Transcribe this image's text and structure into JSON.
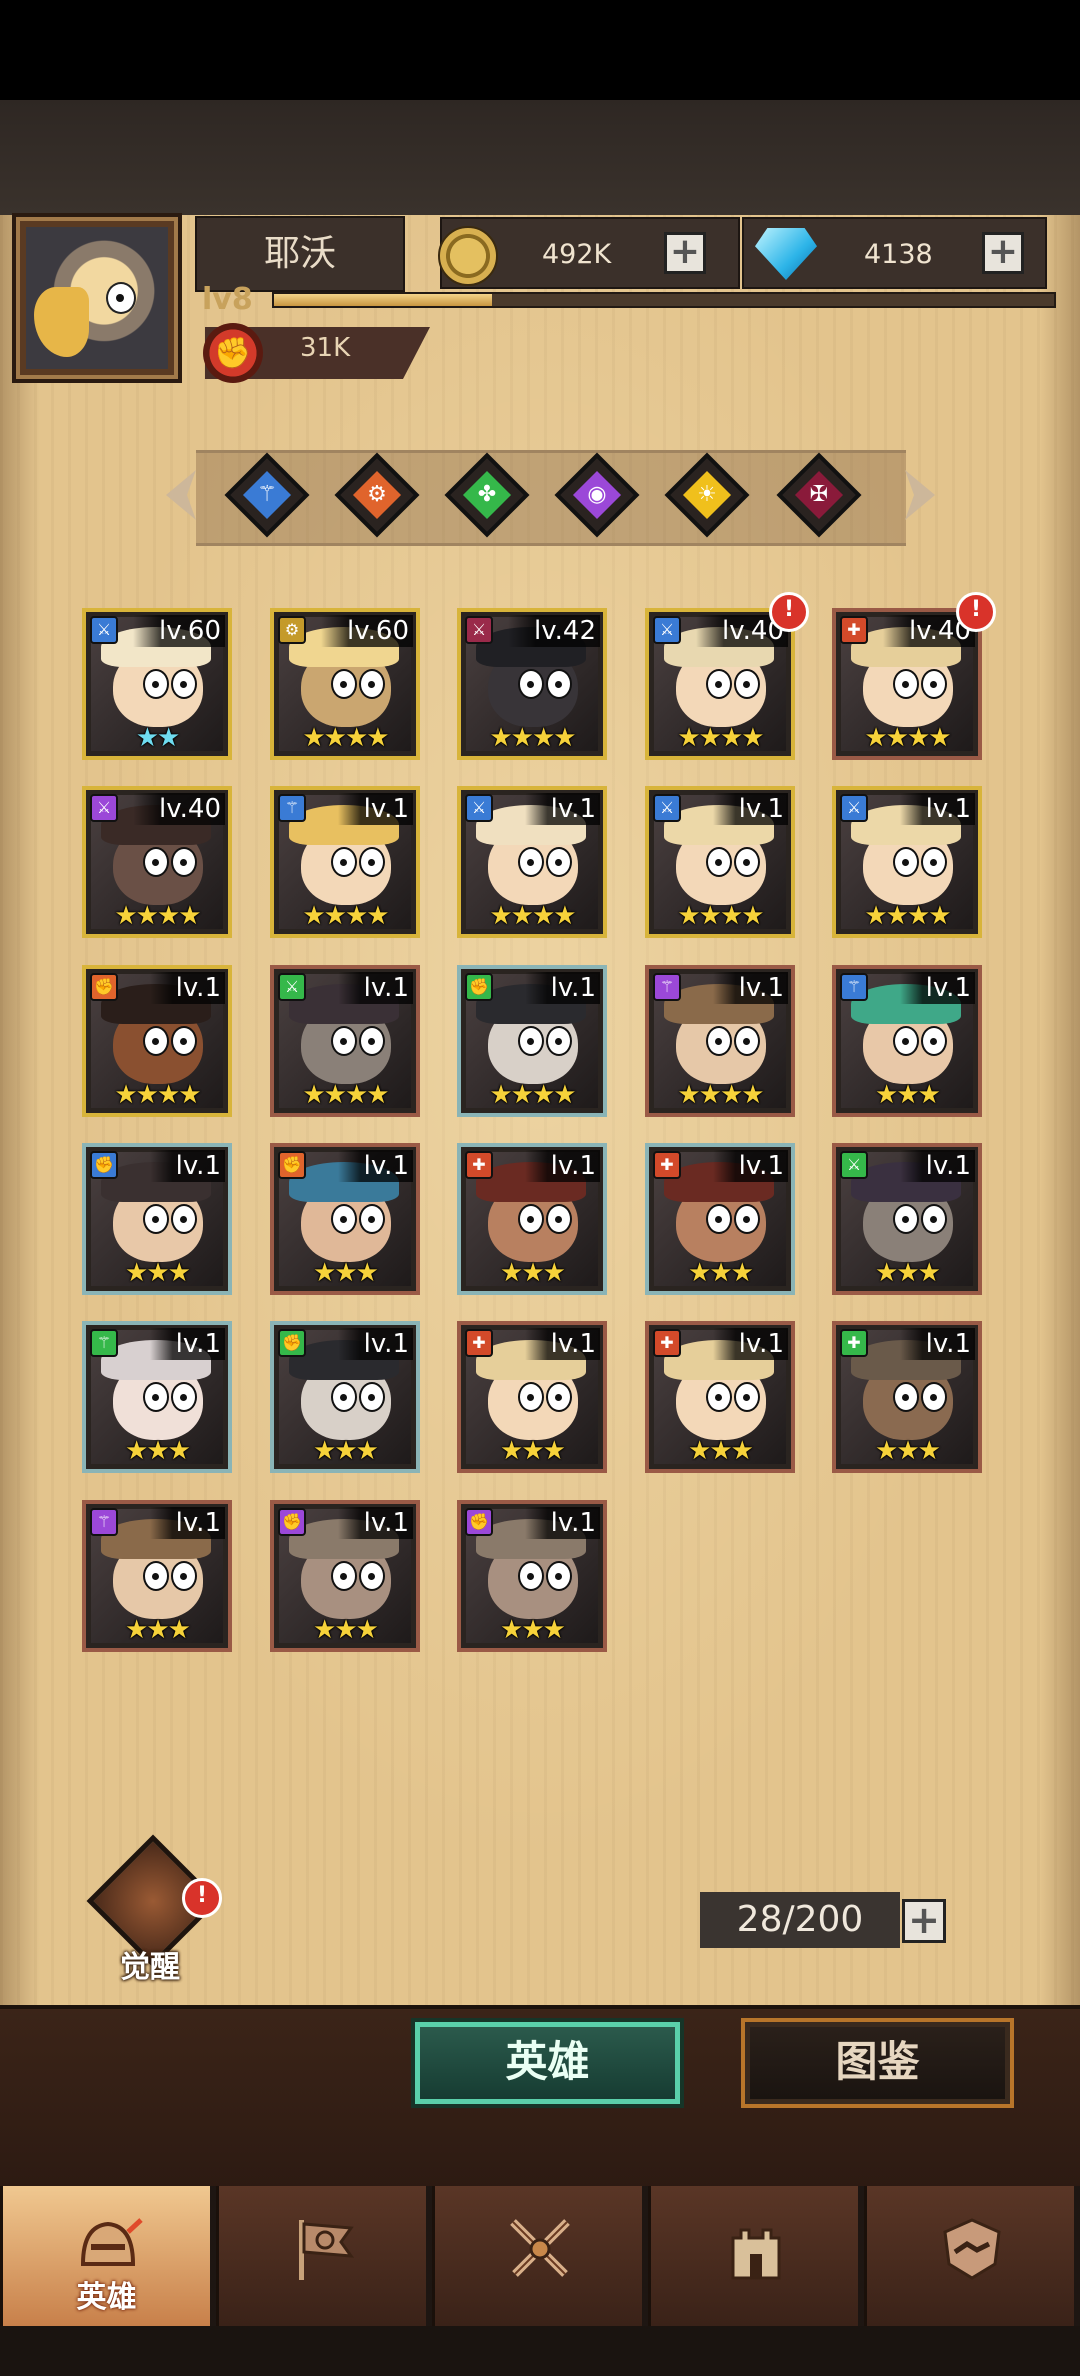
{
  "player": {
    "name": "耶沃",
    "level": "lv8",
    "power": "31K",
    "xp_fraction": 0.28
  },
  "resources": {
    "gold": "492K",
    "gems": "4138"
  },
  "element_filters": [
    {
      "icon": "water-rune-icon",
      "color": "#3a7bd5",
      "glyph": "⚚"
    },
    {
      "icon": "fire-rune-icon",
      "color": "#e0642c",
      "glyph": "⚙"
    },
    {
      "icon": "nature-rune-icon",
      "color": "#35b84a",
      "glyph": "✤"
    },
    {
      "icon": "arcane-rune-icon",
      "color": "#9b48d8",
      "glyph": "◉"
    },
    {
      "icon": "light-rune-icon",
      "color": "#f0c01c",
      "glyph": "☀"
    },
    {
      "icon": "dark-rune-icon",
      "color": "#8a1a3a",
      "glyph": "✠"
    }
  ],
  "heroes": [
    {
      "level": "lv.60",
      "stars": "★★",
      "star_color": "blue",
      "frame": "gold",
      "class_color": "#3a7bd5",
      "class_glyph": "⚔",
      "alert": false,
      "hair": "#f2e6c8",
      "skin": "#f3d8b8"
    },
    {
      "level": "lv.60",
      "stars": "★★★★",
      "star_color": "gold",
      "frame": "gold",
      "class_color": "#c49a2a",
      "class_glyph": "⚙",
      "alert": false,
      "hair": "#f0d690",
      "skin": "#caa670"
    },
    {
      "level": "lv.42",
      "stars": "★★★★",
      "star_color": "gold",
      "frame": "gold",
      "class_color": "#9a2a4a",
      "class_glyph": "⚔",
      "alert": false,
      "hair": "#202024",
      "skin": "#383438"
    },
    {
      "level": "lv.40",
      "stars": "★★★★",
      "star_color": "gold",
      "frame": "gold",
      "class_color": "#3a7bd5",
      "class_glyph": "⚔",
      "alert": true,
      "hair": "#e8d8b0",
      "skin": "#f3d8b8"
    },
    {
      "level": "lv.40",
      "stars": "★★★★",
      "star_color": "gold",
      "frame": "red",
      "class_color": "#d34a2a",
      "class_glyph": "✚",
      "alert": true,
      "hair": "#e6cf9a",
      "skin": "#f3d8b8"
    },
    {
      "level": "lv.40",
      "stars": "★★★★",
      "star_color": "gold",
      "frame": "gold",
      "class_color": "#9b48d8",
      "class_glyph": "⚔",
      "alert": false,
      "hair": "#3a2a26",
      "skin": "#6a5046"
    },
    {
      "level": "lv.1",
      "stars": "★★★★",
      "star_color": "gold",
      "frame": "gold",
      "class_color": "#3a7bd5",
      "class_glyph": "⚚",
      "alert": false,
      "hair": "#e8c060",
      "skin": "#f3d8b8"
    },
    {
      "level": "lv.1",
      "stars": "★★★★",
      "star_color": "gold",
      "frame": "gold",
      "class_color": "#3a7bd5",
      "class_glyph": "⚔",
      "alert": false,
      "hair": "#f0e0c0",
      "skin": "#f3d8b8"
    },
    {
      "level": "lv.1",
      "stars": "★★★★",
      "star_color": "gold",
      "frame": "gold",
      "class_color": "#3a7bd5",
      "class_glyph": "⚔",
      "alert": false,
      "hair": "#ecd8a8",
      "skin": "#f3d8b8"
    },
    {
      "level": "lv.1",
      "stars": "★★★★",
      "star_color": "gold",
      "frame": "gold",
      "class_color": "#3a7bd5",
      "class_glyph": "⚔",
      "alert": false,
      "hair": "#ecd8a8",
      "skin": "#f3d8b8"
    },
    {
      "level": "lv.1",
      "stars": "★★★★",
      "star_color": "gold",
      "frame": "gold",
      "class_color": "#e0642c",
      "class_glyph": "✊",
      "alert": false,
      "hair": "#2a1e1a",
      "skin": "#8a5030"
    },
    {
      "level": "lv.1",
      "stars": "★★★★",
      "star_color": "gold",
      "frame": "red",
      "class_color": "#35b84a",
      "class_glyph": "⚔",
      "alert": false,
      "hair": "#3a3036",
      "skin": "#8a8078"
    },
    {
      "level": "lv.1",
      "stars": "★★★★",
      "star_color": "gold",
      "frame": "teal",
      "class_color": "#35b84a",
      "class_glyph": "✊",
      "alert": false,
      "hair": "#2a2a2e",
      "skin": "#d8d0c8"
    },
    {
      "level": "lv.1",
      "stars": "★★★★",
      "star_color": "gold",
      "frame": "red",
      "class_color": "#9b48d8",
      "class_glyph": "⚚",
      "alert": false,
      "hair": "#8a6a4a",
      "skin": "#e6c8a8"
    },
    {
      "level": "lv.1",
      "stars": "★★★",
      "star_color": "gold",
      "frame": "red",
      "class_color": "#3a7bd5",
      "class_glyph": "⚚",
      "alert": false,
      "hair": "#3fa888",
      "skin": "#e8c8a8"
    },
    {
      "level": "lv.1",
      "stars": "★★★",
      "star_color": "gold",
      "frame": "teal",
      "class_color": "#3a7bd5",
      "class_glyph": "✊",
      "alert": false,
      "hair": "#3a3030",
      "skin": "#e8c8a8"
    },
    {
      "level": "lv.1",
      "stars": "★★★",
      "star_color": "gold",
      "frame": "red",
      "class_color": "#e0642c",
      "class_glyph": "✊",
      "alert": false,
      "hair": "#3a7a9a",
      "skin": "#e0b898"
    },
    {
      "level": "lv.1",
      "stars": "★★★",
      "star_color": "gold",
      "frame": "teal",
      "class_color": "#d34a2a",
      "class_glyph": "✚",
      "alert": false,
      "hair": "#6a2a22",
      "skin": "#b88060"
    },
    {
      "level": "lv.1",
      "stars": "★★★",
      "star_color": "gold",
      "frame": "teal",
      "class_color": "#d34a2a",
      "class_glyph": "✚",
      "alert": false,
      "hair": "#6a2a22",
      "skin": "#b88060"
    },
    {
      "level": "lv.1",
      "stars": "★★★",
      "star_color": "gold",
      "frame": "red",
      "class_color": "#35b84a",
      "class_glyph": "⚔",
      "alert": false,
      "hair": "#3a3040",
      "skin": "#8a8078"
    },
    {
      "level": "lv.1",
      "stars": "★★★",
      "star_color": "gold",
      "frame": "teal",
      "class_color": "#35b84a",
      "class_glyph": "⚚",
      "alert": false,
      "hair": "#d8d0d0",
      "skin": "#f0e0d8"
    },
    {
      "level": "lv.1",
      "stars": "★★★",
      "star_color": "gold",
      "frame": "teal",
      "class_color": "#35b84a",
      "class_glyph": "✊",
      "alert": false,
      "hair": "#2a2a2e",
      "skin": "#d8d0c8"
    },
    {
      "level": "lv.1",
      "stars": "★★★",
      "star_color": "gold",
      "frame": "red",
      "class_color": "#d34a2a",
      "class_glyph": "✚",
      "alert": false,
      "hair": "#e6cf9a",
      "skin": "#f3d8b8"
    },
    {
      "level": "lv.1",
      "stars": "★★★",
      "star_color": "gold",
      "frame": "red",
      "class_color": "#d34a2a",
      "class_glyph": "✚",
      "alert": false,
      "hair": "#e6cf9a",
      "skin": "#f3d8b8"
    },
    {
      "level": "lv.1",
      "stars": "★★★",
      "star_color": "gold",
      "frame": "red",
      "class_color": "#35b84a",
      "class_glyph": "✚",
      "alert": false,
      "hair": "#6a5a4a",
      "skin": "#8a6a50"
    },
    {
      "level": "lv.1",
      "stars": "★★★",
      "star_color": "gold",
      "frame": "red",
      "class_color": "#9b48d8",
      "class_glyph": "⚚",
      "alert": false,
      "hair": "#8a6a4a",
      "skin": "#e6c8a8"
    },
    {
      "level": "lv.1",
      "stars": "★★★",
      "star_color": "gold",
      "frame": "red",
      "class_color": "#9b48d8",
      "class_glyph": "✊",
      "alert": false,
      "hair": "#8a7a6a",
      "skin": "#a89080"
    },
    {
      "level": "lv.1",
      "stars": "★★★",
      "star_color": "gold",
      "frame": "red",
      "class_color": "#9b48d8",
      "class_glyph": "✊",
      "alert": false,
      "hair": "#8a7a6a",
      "skin": "#a89080"
    }
  ],
  "awaken": {
    "label": "觉醒"
  },
  "hero_count": "28/200",
  "tabs": {
    "heroes": "英雄",
    "codex": "图鉴"
  },
  "nav": [
    {
      "label": "英雄",
      "icon": "helmet-icon"
    },
    {
      "label": "",
      "icon": "war-flag-icon"
    },
    {
      "label": "",
      "icon": "crossed-swords-icon"
    },
    {
      "label": "",
      "icon": "castle-icon"
    },
    {
      "label": "",
      "icon": "guild-handshake-icon"
    }
  ]
}
